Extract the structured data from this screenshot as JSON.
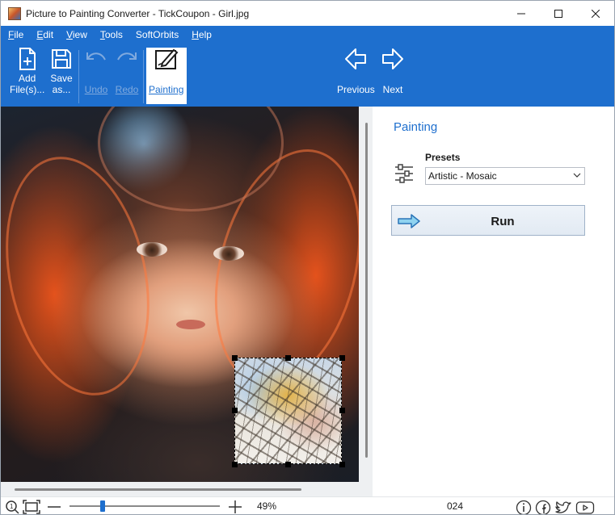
{
  "window": {
    "title": "Picture to Painting Converter - TickCoupon - Girl.jpg"
  },
  "menu": [
    {
      "label": "File",
      "accel": "F",
      "rest": "ile"
    },
    {
      "label": "Edit",
      "accel": "E",
      "rest": "dit"
    },
    {
      "label": "View",
      "accel": "V",
      "rest": "iew"
    },
    {
      "label": "Tools",
      "accel": "T",
      "rest": "ools"
    },
    {
      "label": "SoftOrbits",
      "accel": "",
      "rest": "SoftOrbits"
    },
    {
      "label": "Help",
      "accel": "H",
      "rest": "elp"
    }
  ],
  "toolbar": {
    "add_line1": "Add",
    "add_line2": "File(s)...",
    "save_line1": "Save",
    "save_line2": "as...",
    "undo": "Undo",
    "redo": "Redo",
    "painting": "Painting",
    "previous": "Previous",
    "next": "Next"
  },
  "panel": {
    "title": "Painting",
    "presets_label": "Presets",
    "presets_value": "Artistic - Mosaic",
    "run_label": "Run"
  },
  "statusbar": {
    "zoom": "49%",
    "year_fragment": "024",
    "zoom_level": 0.49
  },
  "colors": {
    "accent": "#1e6fce",
    "ribbon": "#1e6fce",
    "disabled": "#7fa9de"
  }
}
